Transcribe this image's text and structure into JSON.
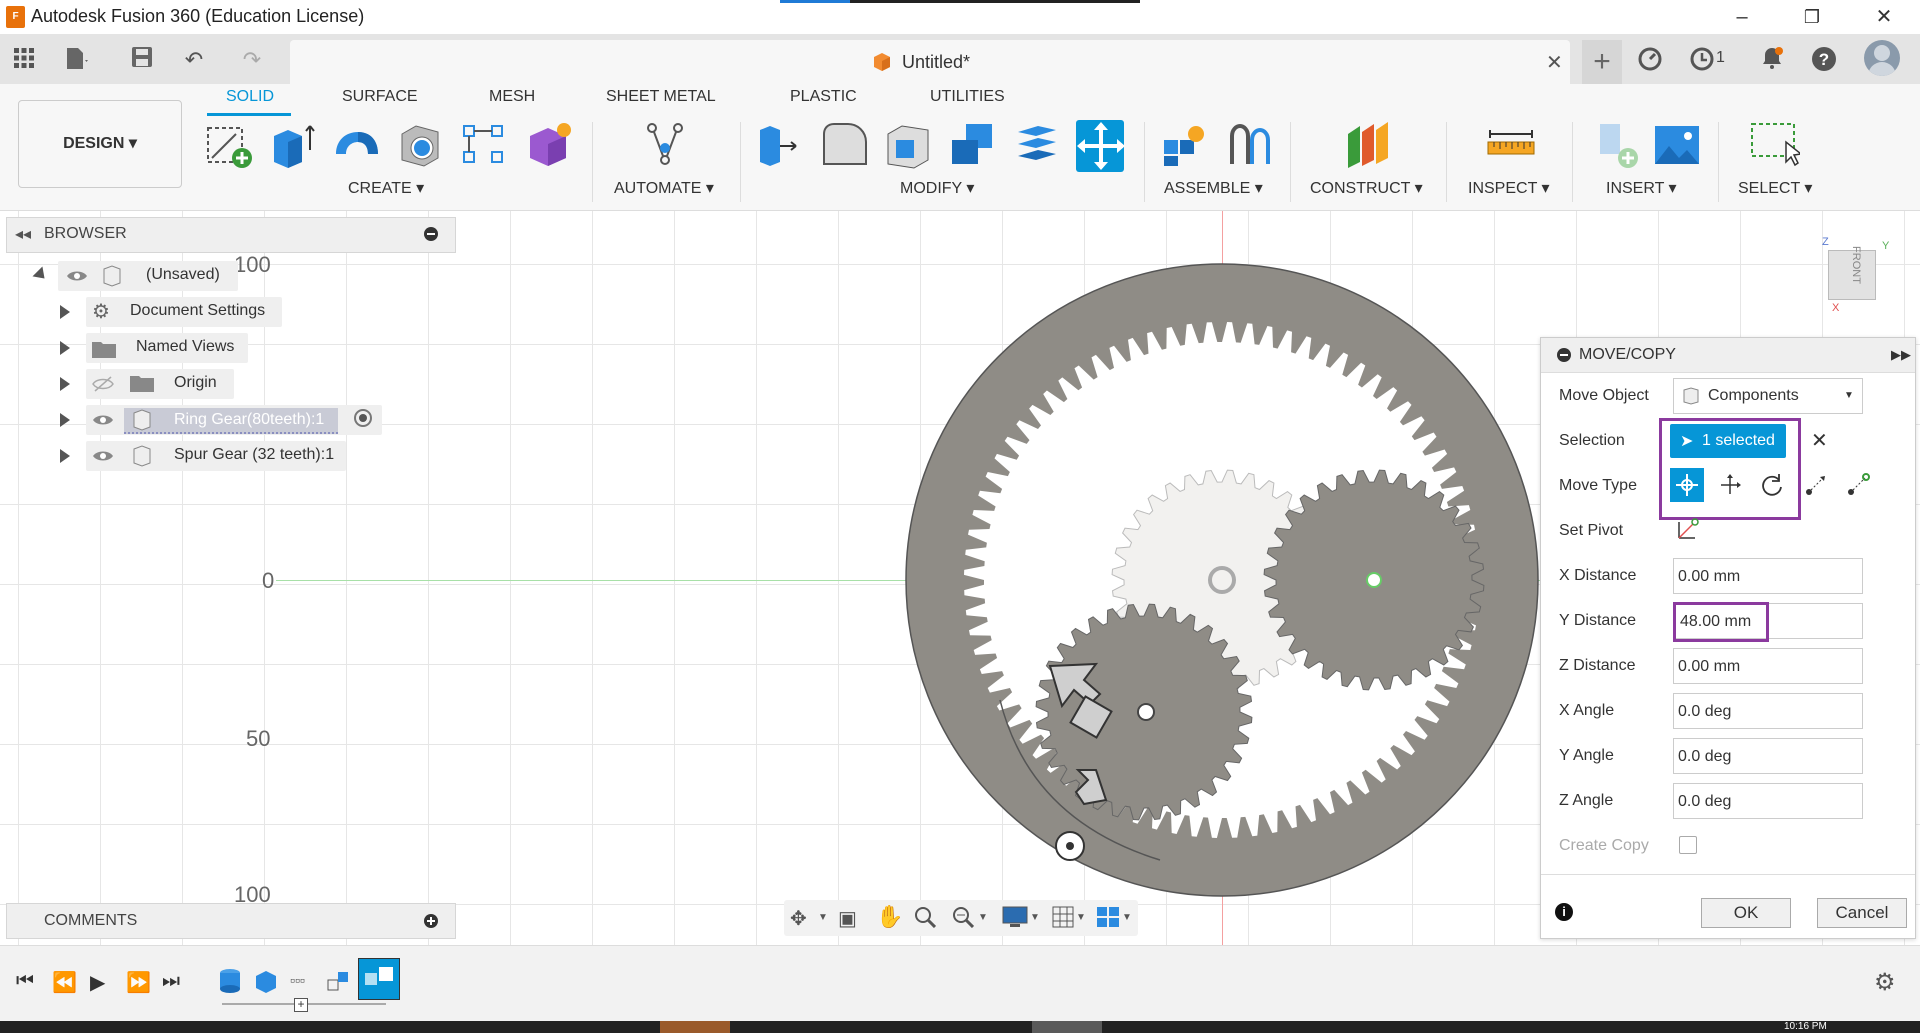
{
  "window": {
    "title": "Autodesk Fusion 360 (Education License)",
    "app_icon_text": "F"
  },
  "document": {
    "title": "Untitled*",
    "jobs_count": "1"
  },
  "toolbar": {
    "workspace": "DESIGN ▾",
    "tabs": [
      "SOLID",
      "SURFACE",
      "MESH",
      "SHEET METAL",
      "PLASTIC",
      "UTILITIES"
    ],
    "groups": [
      "CREATE ▾",
      "AUTOMATE ▾",
      "MODIFY ▾",
      "ASSEMBLE ▾",
      "CONSTRUCT ▾",
      "INSPECT ▾",
      "INSERT ▾",
      "SELECT ▾"
    ]
  },
  "browser": {
    "title": "BROWSER",
    "root": "(Unsaved)",
    "items": [
      "Document Settings",
      "Named Views",
      "Origin",
      "Ring Gear(80teeth):1",
      "Spur Gear (32 teeth):1"
    ]
  },
  "comments": {
    "title": "COMMENTS"
  },
  "axis_labels": [
    "100",
    "0",
    "50",
    "100"
  ],
  "viewcube": {
    "face": "FRONT",
    "z": "Z",
    "y": "Y",
    "x": "X"
  },
  "move_copy": {
    "title": "MOVE/COPY",
    "labels": {
      "move_object": "Move Object",
      "selection": "Selection",
      "move_type": "Move Type",
      "set_pivot": "Set Pivot",
      "x_distance": "X Distance",
      "y_distance": "Y Distance",
      "z_distance": "Z Distance",
      "x_angle": "X Angle",
      "y_angle": "Y Angle",
      "z_angle": "Z Angle",
      "create_copy": "Create Copy"
    },
    "values": {
      "move_object": "Components",
      "selection": "1 selected",
      "x_distance": "0.00 mm",
      "y_distance": "48.00 mm",
      "z_distance": "0.00 mm",
      "x_angle": "0.0 deg",
      "y_angle": "0.0 deg",
      "z_angle": "0.0 deg"
    },
    "ok": "OK",
    "cancel": "Cancel"
  },
  "taskbar": {
    "clock": "10:16 PM"
  }
}
